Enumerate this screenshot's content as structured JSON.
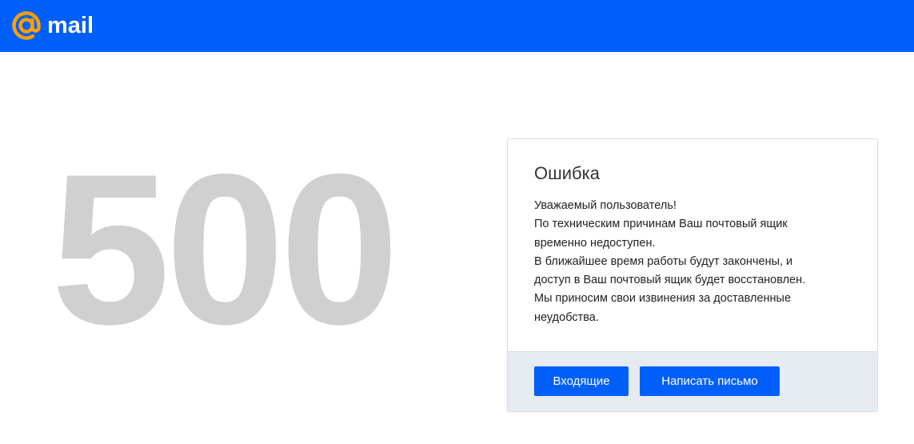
{
  "header": {
    "logo_text": "mail",
    "brand_color": "#005ff9",
    "logo_icon": "at-sign-icon",
    "logo_icon_color": "#ff9e00"
  },
  "error": {
    "code": "500",
    "title": "Ошибка",
    "lines": [
      "Уважаемый пользователь!",
      "По техническим причинам Ваш почтовый ящик",
      "временно недоступен.",
      "В ближайшее время работы будут закончены, и",
      "доступ в Ваш почтовый ящик будет восстановлен.",
      "Мы приносим свои извинения за доставленные",
      "неудобства."
    ]
  },
  "actions": {
    "inbox_label": "Входящие",
    "write_label": "Написать письмо"
  }
}
